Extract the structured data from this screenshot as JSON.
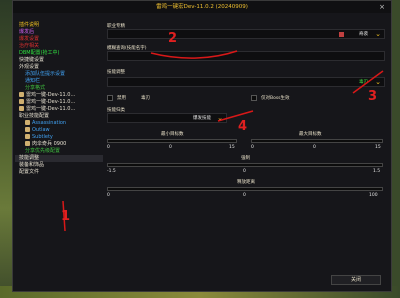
{
  "window": {
    "title": "雷鸡一键宏Dev-11.0.2 (20240909)"
  },
  "sidebar": {
    "items": [
      {
        "label": "插件说明",
        "color": "#f0c020"
      },
      {
        "label": "爆发后",
        "color": "#d060f0"
      },
      {
        "label": "爆发设置",
        "color": "#e03030"
      },
      {
        "label": "治疗相关",
        "color": "#e03030"
      },
      {
        "label": "DBM配置(抢工中)",
        "color": "#30e040"
      },
      {
        "label": "快捷键设置",
        "color": "#e8e8e8"
      },
      {
        "label": "外观设置",
        "color": "#e8e8e8"
      },
      {
        "label": "添加队伍提示设置",
        "color": "#40a0f0"
      },
      {
        "label": "通知栏",
        "color": "#40a0f0"
      },
      {
        "label": "分享格式",
        "color": "#40c040"
      },
      {
        "label": "雷鸡一键-Dev-11.0...",
        "color": "#e8e8e8"
      },
      {
        "label": "雷鸡一键-Dev-11.0...",
        "color": "#e8e8e8"
      },
      {
        "label": "雷鸡一键-Dev-11.0...",
        "color": "#e8e8e8"
      },
      {
        "label": "职业技能配置",
        "color": "#e8e8e8"
      },
      {
        "label": "Assassination",
        "color": "#40a0f0"
      },
      {
        "label": "Outlaw",
        "color": "#40a0f0"
      },
      {
        "label": "Subtlety",
        "color": "#40a0f0"
      },
      {
        "label": "肉伞奇兵 0900",
        "color": "#e8e8e8"
      },
      {
        "label": "分享优先级配置",
        "color": "#40c040"
      },
      {
        "label": "技能调整",
        "color": "#e8e8e8"
      },
      {
        "label": "装备和饰品",
        "color": "#e8e8e8"
      },
      {
        "label": "配置文件",
        "color": "#e8e8e8"
      }
    ]
  },
  "main": {
    "profession_label": "职业专精",
    "profession_value": "奇袭",
    "skill_query_label": "模糊查询(技能名字)",
    "skill_query_value": "",
    "skill_adjust_label": "技能调整",
    "skill_adjust_value": "毒刃",
    "disable_label": "禁用",
    "disable_value": "毒刃",
    "boss_only_label": "仅对Boss生效",
    "skill_type_label": "技能归类",
    "skill_type_value": "爆发技能",
    "min_targets_label": "最小目标数",
    "min_targets_value": "0",
    "max_targets_label": "最大目标数",
    "max_targets_value": "0",
    "min_range_left": "0",
    "min_range_right": "15",
    "max_range_left": "0",
    "max_range_right": "15",
    "strength_label": "强制",
    "strength_value": "0",
    "strength_min": "-1.5",
    "strength_max": "1.5",
    "cast_distance_label": "释放距离",
    "cast_distance_value": "0",
    "cast_distance_min": "0",
    "cast_distance_max": "100",
    "close_button_label": "关闭"
  },
  "annotations": [
    "2",
    "3",
    "4",
    "1"
  ]
}
